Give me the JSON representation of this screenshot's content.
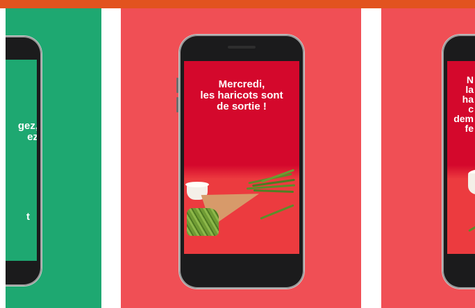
{
  "header_bar": {
    "color": "#e2531f"
  },
  "colors": {
    "green_panel": "#1ea871",
    "red_panel": "#f04f55",
    "screen_red": "#d4082c"
  },
  "left_card": {
    "text_lines": [
      "gez,",
      "ez"
    ],
    "bottom_mark": "t"
  },
  "center_card": {
    "text_lines": [
      "Mercredi,",
      "les haricots sont",
      "de sortie !"
    ]
  },
  "right_card": {
    "text_lines": [
      "N",
      "la",
      "ha",
      "c",
      "dem",
      "fe"
    ]
  }
}
